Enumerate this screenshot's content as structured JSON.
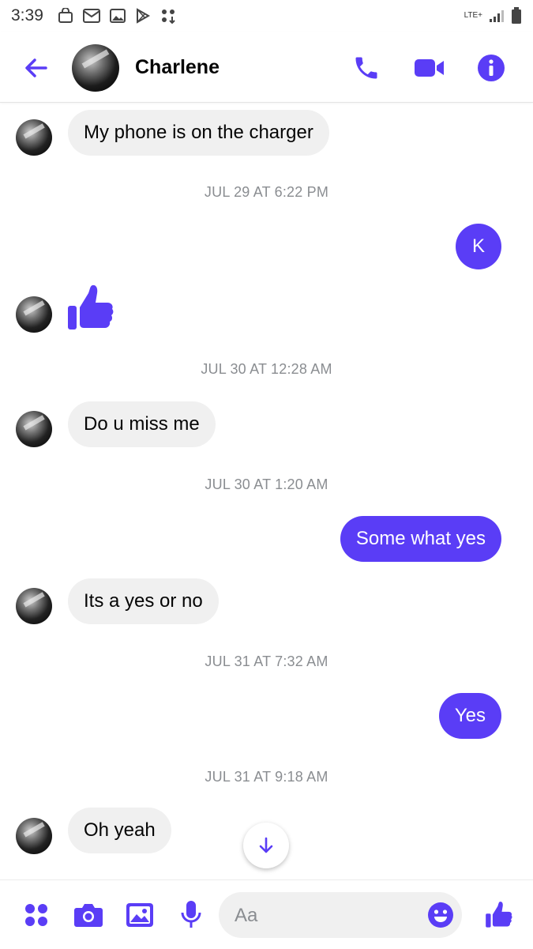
{
  "status_bar": {
    "time": "3:39",
    "network": "LTE+"
  },
  "header": {
    "contact_name": "Charlene",
    "icons": {
      "back": "arrow-left-icon",
      "call": "phone-icon",
      "video": "video-camera-icon",
      "info": "info-icon"
    }
  },
  "thread": {
    "messages": [
      {
        "type": "incoming",
        "text": "My phone is on the charger"
      },
      {
        "type": "timestamp",
        "text": "JUL 29 AT 6:22 PM"
      },
      {
        "type": "outgoing",
        "text": "K"
      },
      {
        "type": "incoming-like",
        "icon": "thumbs-up-icon"
      },
      {
        "type": "timestamp",
        "text": "JUL 30 AT 12:28 AM"
      },
      {
        "type": "incoming",
        "text": "Do u miss me"
      },
      {
        "type": "timestamp",
        "text": "JUL 30 AT 1:20 AM"
      },
      {
        "type": "outgoing",
        "text": "Some what yes"
      },
      {
        "type": "incoming",
        "text": "Its a yes or no"
      },
      {
        "type": "timestamp",
        "text": "JUL 31 AT 7:32 AM"
      },
      {
        "type": "outgoing",
        "text": "Yes"
      },
      {
        "type": "timestamp",
        "text": "JUL 31 AT 9:18 AM"
      },
      {
        "type": "incoming",
        "text": "Oh yeah"
      }
    ]
  },
  "composer": {
    "placeholder": "Aa",
    "icons": [
      "apps-icon",
      "camera-icon",
      "image-icon",
      "microphone-icon",
      "emoji-icon",
      "thumbs-up-icon"
    ]
  },
  "colors": {
    "accent": "#5a3df6",
    "incoming_bubble": "#f0f0f0",
    "timestamp": "#8a8d91"
  }
}
